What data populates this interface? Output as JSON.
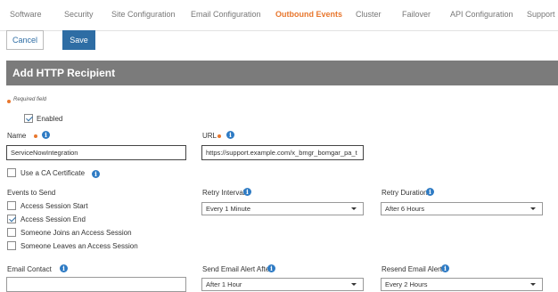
{
  "tabs": [
    {
      "label": "Software"
    },
    {
      "label": "Security"
    },
    {
      "label": "Site Configuration"
    },
    {
      "label": "Email Configuration"
    },
    {
      "label": "Outbound Events"
    },
    {
      "label": "Cluster"
    },
    {
      "label": "Failover"
    },
    {
      "label": "API Configuration"
    },
    {
      "label": "Support"
    }
  ],
  "active_tab": "Outbound Events",
  "toolbar": {
    "cancel_label": "Cancel",
    "save_label": "Save"
  },
  "form": {
    "title": "Add HTTP Recipient",
    "required_note": "Required field",
    "enabled_label": "Enabled",
    "enabled_checked": true,
    "name_label": "Name",
    "name_value": "ServiceNowIntegration",
    "url_label": "URL",
    "url_value": "https://support.example.com/x_bmgr_bomgar_pa_t",
    "ca_cert_label": "Use a CA Certificate",
    "ca_cert_checked": false,
    "events_label": "Events to Send",
    "events": [
      {
        "label": "Access Session Start",
        "checked": false
      },
      {
        "label": "Access Session End",
        "checked": true
      },
      {
        "label": "Someone Joins an Access Session",
        "checked": false
      },
      {
        "label": "Someone Leaves an Access Session",
        "checked": false
      }
    ],
    "retry_interval_label": "Retry Interval",
    "retry_interval_value": "Every 1 Minute",
    "retry_duration_label": "Retry Duration",
    "retry_duration_value": "After 6 Hours",
    "email_contact_label": "Email Contact",
    "email_contact_value": "",
    "send_alert_label": "Send Email Alert After",
    "send_alert_value": "After 1 Hour",
    "resend_label": "Resend Email Alerts",
    "resend_value": "Every 2 Hours"
  },
  "colors": {
    "accent": "#e8772e",
    "primary": "#2e6da4",
    "header_bg": "#7b7b7b",
    "info_icon": "#2e7bc4"
  },
  "icons": {
    "info": "info-icon",
    "dropdown": "chevron-down-icon",
    "required": "required-dot"
  }
}
